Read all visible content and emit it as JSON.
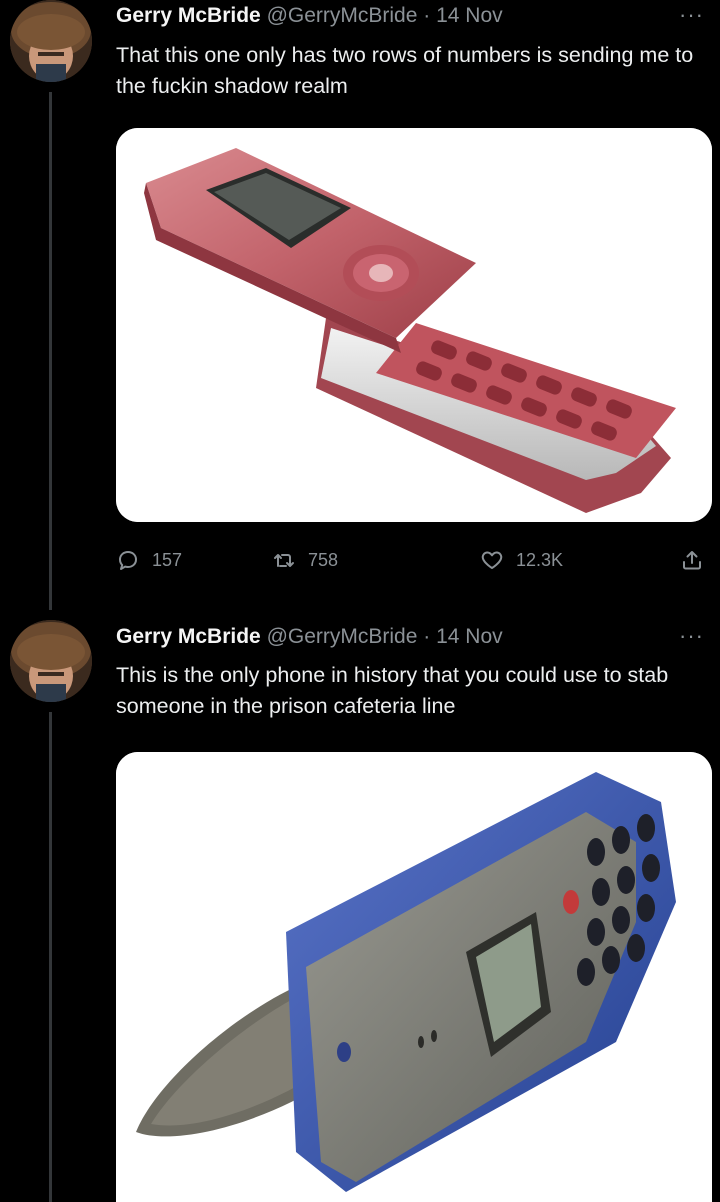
{
  "tweets": [
    {
      "author_name": "Gerry McBride",
      "handle": "@GerryMcBride",
      "separator": "·",
      "date": "14 Nov",
      "more": "···",
      "text": "That this one only has two rows of numbers is sending me to the fuckin shadow realm",
      "image_alt": "Red Samsung slider phone with keypad",
      "replies": "157",
      "retweets": "758",
      "likes": "12.3K"
    },
    {
      "author_name": "Gerry McBride",
      "handle": "@GerryMcBride",
      "separator": "·",
      "date": "14 Nov",
      "more": "···",
      "text": "This is the only phone in history that you could use to stab someone in the prison cafeteria line",
      "image_alt": "Blue and grey Ericsson phone with pointed antenna"
    }
  ],
  "icons": {
    "reply": "reply-icon",
    "retweet": "retweet-icon",
    "like": "heart-icon",
    "share": "share-icon"
  },
  "colors": {
    "background": "#000000",
    "text": "#e7e9ea",
    "muted": "#8b9196",
    "thread_line": "#333639"
  }
}
